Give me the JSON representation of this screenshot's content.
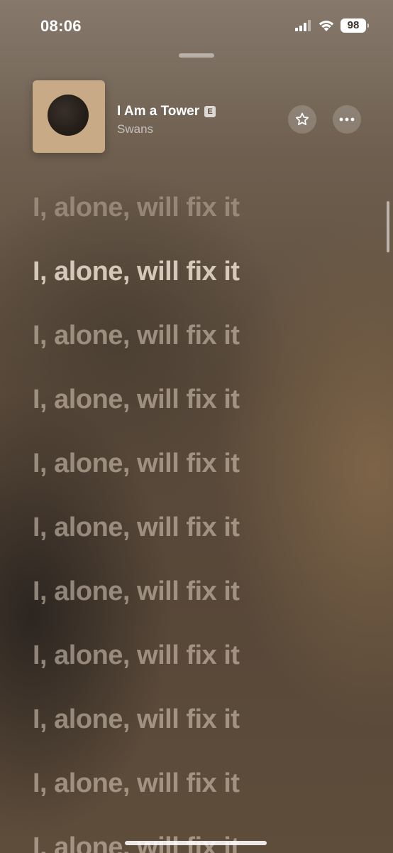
{
  "status_bar": {
    "time": "08:06",
    "battery": "98",
    "icons": [
      "cellular-signal-icon",
      "wifi-icon",
      "battery-icon"
    ]
  },
  "now_playing": {
    "title": "I Am a Tower",
    "explicit_badge": "E",
    "artist": "Swans",
    "album_art": "album-art-disc"
  },
  "actions": {
    "favorite_icon": "star-icon",
    "more_icon": "ellipsis-icon"
  },
  "lyrics": [
    "I, alone, will fix it",
    "I, alone, will fix it",
    "I, alone, will fix it",
    "I, alone, will fix it",
    "I, alone, will fix it",
    "I, alone, will fix it",
    "I, alone, will fix it",
    "I, alone, will fix it",
    "I, alone, will fix it",
    "I, alone, will fix it",
    "I, alone, will fix it"
  ],
  "active_lyric_index": 1,
  "colors": {
    "background": "#5a4a3a",
    "lyric_active": "#f0e4d6",
    "lyric_inactive": "#dccdbe"
  }
}
